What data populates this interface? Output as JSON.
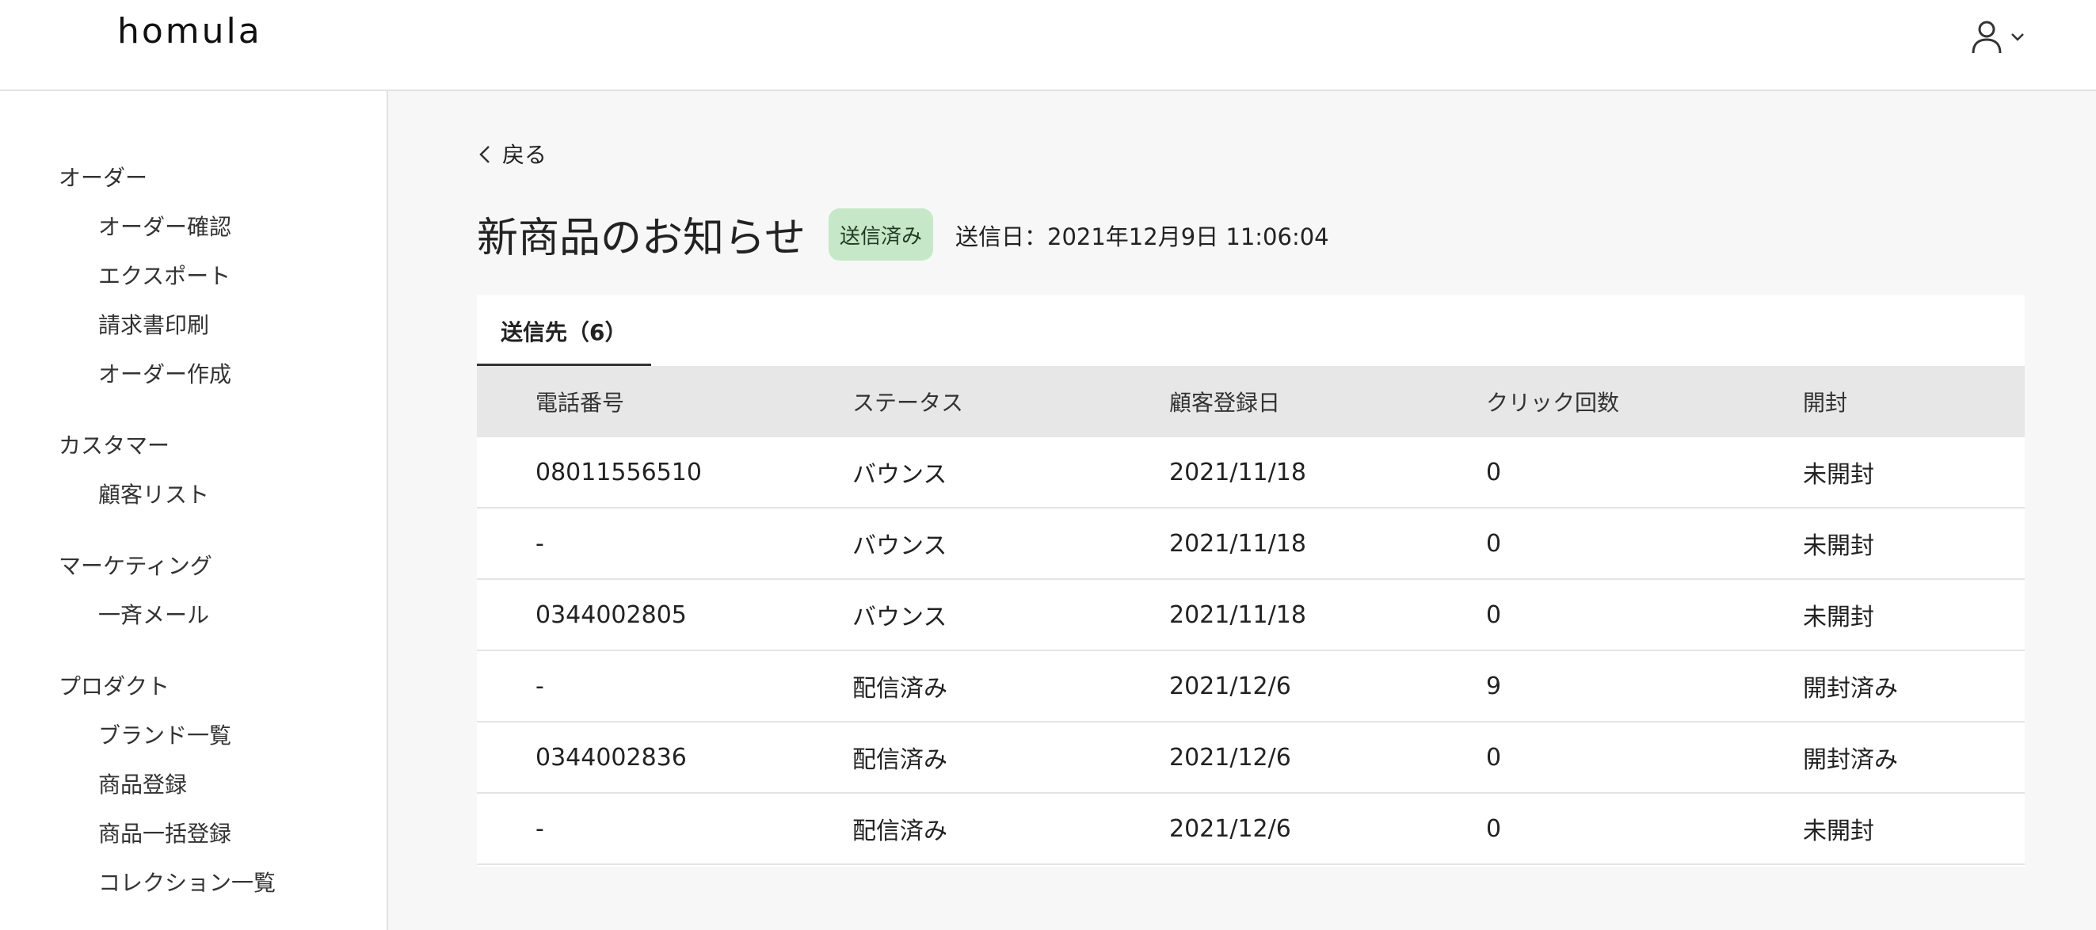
{
  "header": {
    "logo": "homula"
  },
  "sidebar": {
    "groups": [
      {
        "label": "オーダー",
        "items": [
          "オーダー確認",
          "エクスポート",
          "請求書印刷",
          "オーダー作成"
        ]
      },
      {
        "label": "カスタマー",
        "items": [
          "顧客リスト"
        ]
      },
      {
        "label": "マーケティング",
        "items": [
          "一斉メール"
        ]
      },
      {
        "label": "プロダクト",
        "items": [
          "ブランド一覧",
          "商品登録",
          "商品一括登録",
          "コレクション一覧"
        ]
      }
    ]
  },
  "main": {
    "back_label": "戻る",
    "title": "新商品のお知らせ",
    "status_badge": "送信済み",
    "sent_date": "送信日：2021年12月9日 11:06:04",
    "tab_label": "送信先（6）",
    "table": {
      "columns": [
        "電話番号",
        "ステータス",
        "顧客登録日",
        "クリック回数",
        "開封"
      ],
      "rows": [
        [
          "08011556510",
          "バウンス",
          "2021/11/18",
          "0",
          "未開封"
        ],
        [
          "-",
          "バウンス",
          "2021/11/18",
          "0",
          "未開封"
        ],
        [
          "0344002805",
          "バウンス",
          "2021/11/18",
          "0",
          "未開封"
        ],
        [
          "-",
          "配信済み",
          "2021/12/6",
          "9",
          "開封済み"
        ],
        [
          "0344002836",
          "配信済み",
          "2021/12/6",
          "0",
          "開封済み"
        ],
        [
          "-",
          "配信済み",
          "2021/12/6",
          "0",
          "未開封"
        ]
      ]
    }
  },
  "icons": {
    "user": "user-icon",
    "chevron": "chevron-down-icon",
    "back": "chevron-left-icon"
  },
  "colors": {
    "badge_bg": "#c6e8c9",
    "header_row_bg": "#e7e7e7"
  }
}
